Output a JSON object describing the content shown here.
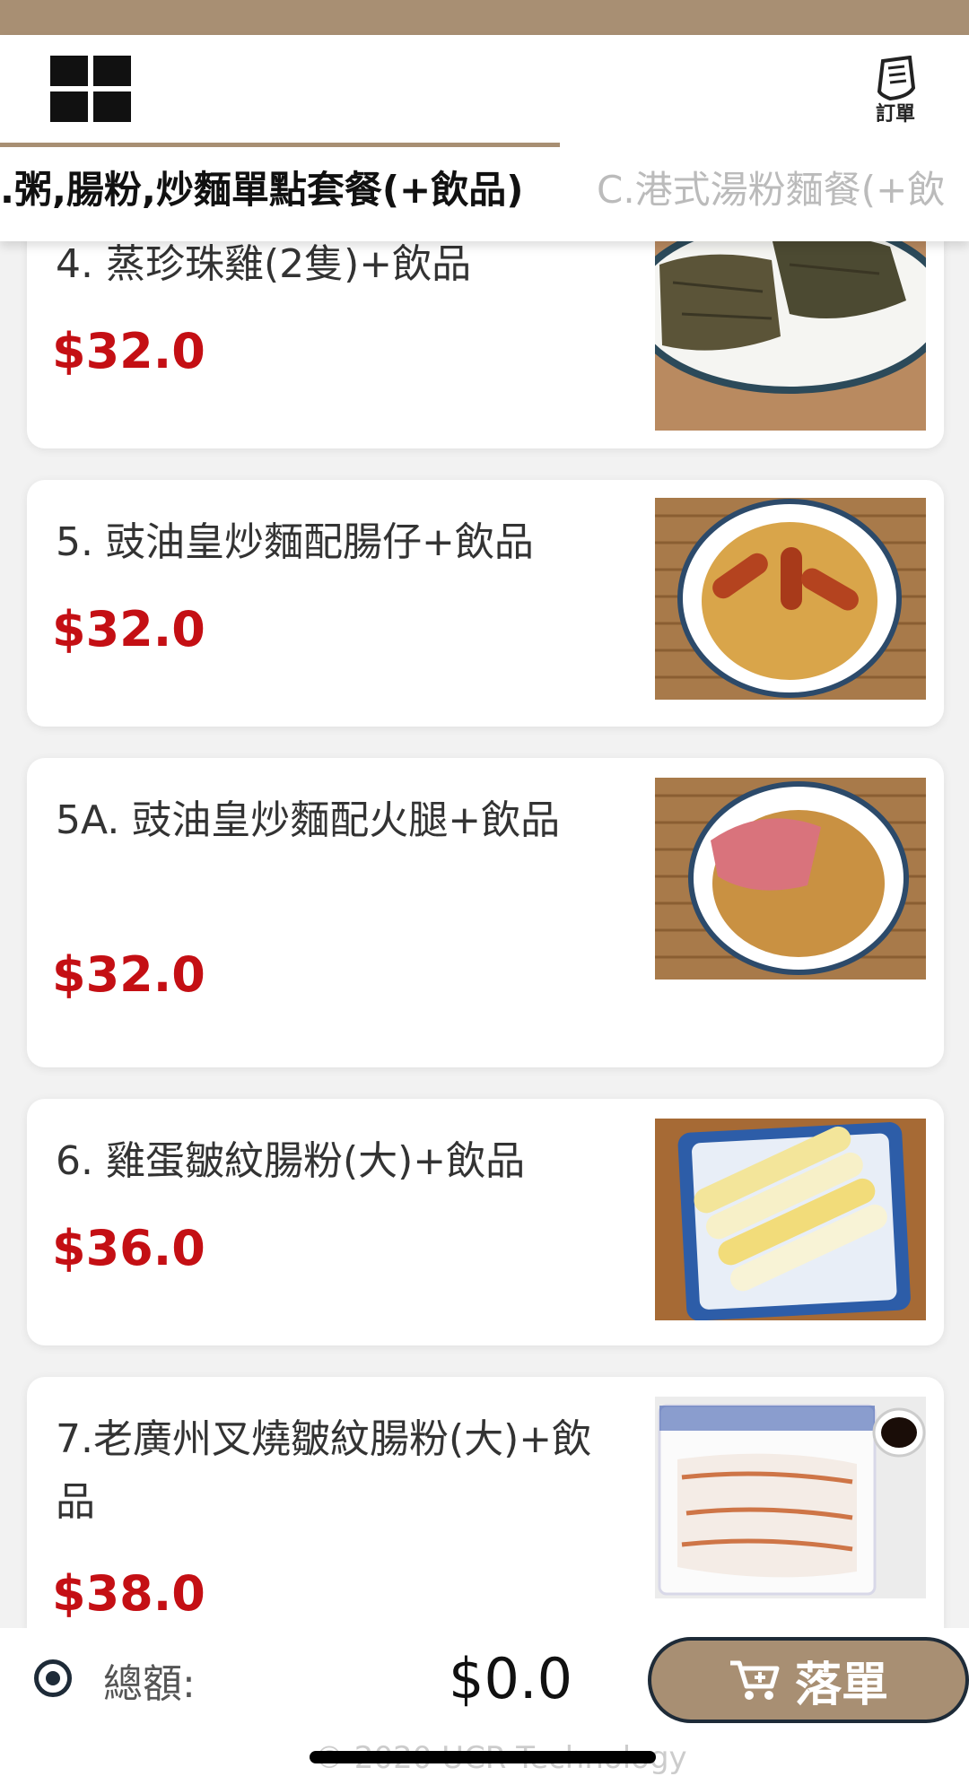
{
  "header": {
    "orders_label": "訂單",
    "tabs": [
      {
        "label": ".粥,腸粉,炒麵單點套餐(+飲品)",
        "active": true
      },
      {
        "label": "C.港式湯粉麵餐(+飲",
        "active": false
      }
    ]
  },
  "menu": {
    "items": [
      {
        "name": "4. 蒸珍珠雞(2隻)+飲品",
        "price": "$32.0",
        "image": "lotus-leaf-chicken-photo"
      },
      {
        "name": "5. 豉油皇炒麵配腸仔+飲品",
        "price": "$32.0",
        "image": "noodles-sausage-photo"
      },
      {
        "name": "5A. 豉油皇炒麵配火腿+飲品",
        "price": "$32.0",
        "image": "noodles-ham-photo"
      },
      {
        "name": "6. 雞蛋皺紋腸粉(大)+飲品",
        "price": "$36.0",
        "image": "egg-rice-roll-photo"
      },
      {
        "name": "7.老廣州叉燒皺紋腸粉(大)+飲品",
        "price": "$38.0",
        "image": "char-siu-rice-roll-photo"
      }
    ]
  },
  "footer": {
    "total_label": "總額:",
    "total_value": "$0.0",
    "order_button_label": "落單",
    "copyright": "© 2020 UCR Technology"
  },
  "colors": {
    "accent": "#a88f73",
    "price": "#c40f14",
    "dark": "#1e2b38"
  }
}
